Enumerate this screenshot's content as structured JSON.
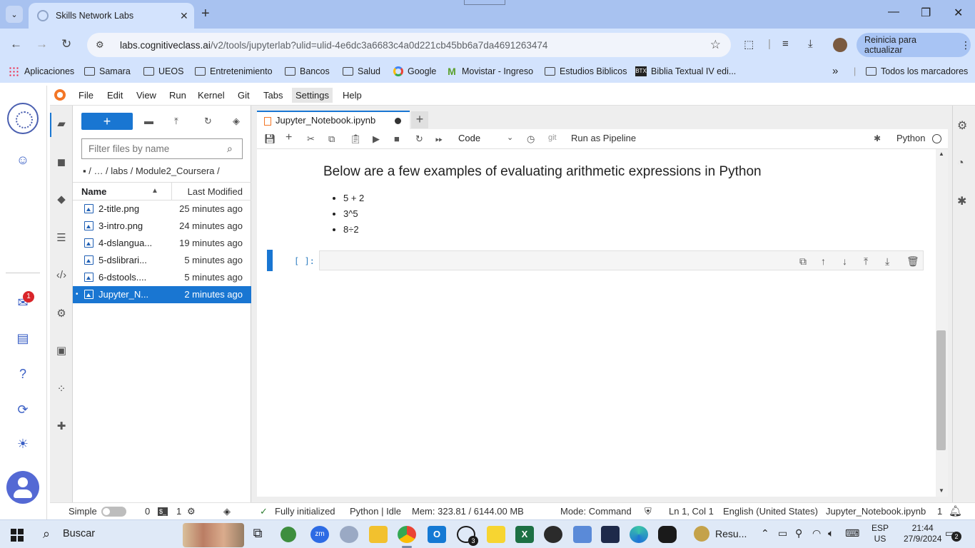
{
  "browser": {
    "tab_title": "Skills Network Labs",
    "tab_close": "✕",
    "new_tab": "+",
    "url_host": "labs.cognitiveclass.ai",
    "url_path": "/v2/tools/jupyterlab?ulid=ulid-4e6dc3a6683c4a0d221cb45bb6a7da4691263474",
    "update_button": "Reinicia para actualizar",
    "window_controls": {
      "minimize": "—",
      "restore": "❐",
      "close": "✕"
    }
  },
  "bookmarks": [
    {
      "label": "Aplicaciones",
      "icon": "apps-grid-icon"
    },
    {
      "label": "Samara",
      "icon": "folder-icon"
    },
    {
      "label": "UEOS",
      "icon": "folder-icon"
    },
    {
      "label": "Entretenimiento",
      "icon": "folder-icon"
    },
    {
      "label": "Bancos",
      "icon": "folder-icon"
    },
    {
      "label": "Salud",
      "icon": "folder-icon"
    },
    {
      "label": "Google",
      "icon": "google-icon"
    },
    {
      "label": "Movistar - Ingreso",
      "icon": "movistar-icon"
    },
    {
      "label": "Estudios Biblicos",
      "icon": "folder-icon"
    },
    {
      "label": "Biblia Textual IV edi...",
      "icon": "bible-icon"
    }
  ],
  "bookmarks_overflow": "»",
  "bookmarks_all": "Todos los marcadores",
  "jupyter_menu": [
    "File",
    "Edit",
    "View",
    "Run",
    "Kernel",
    "Git",
    "Tabs",
    "Settings",
    "Help"
  ],
  "skills_network": {
    "notification_count": "1",
    "icons": [
      "skills-network-logo-icon",
      "chat-icon",
      "inbox-icon",
      "document-icon",
      "help-icon",
      "refresh-icon",
      "theme-icon",
      "user-avatar-icon"
    ]
  },
  "file_browser": {
    "new_button": "+",
    "filter_placeholder": "Filter files by name",
    "breadcrumb": "▪ /   …   / labs / Module2_Coursera /",
    "col_name": "Name",
    "col_modified": "Last Modified",
    "files": [
      {
        "name": "2-title.png",
        "modified": "25 minutes ago"
      },
      {
        "name": "3-intro.png",
        "modified": "24 minutes ago"
      },
      {
        "name": "4-dslangua...",
        "modified": "19 minutes ago"
      },
      {
        "name": "5-dslibrari...",
        "modified": "5 minutes ago"
      },
      {
        "name": "6-dstools....",
        "modified": "5 minutes ago"
      },
      {
        "name": "Jupyter_N...",
        "modified": "2 minutes ago",
        "selected": true
      }
    ]
  },
  "notebook": {
    "tab_title": "Jupyter_Notebook.ipynb",
    "cell_type": "Code",
    "run_pipeline": "Run as Pipeline",
    "git_label": "git",
    "kernel": "Python",
    "heading": "Below are a few examples of evaluating arithmetic expressions in Python",
    "examples": [
      "5 + 2",
      "3^5",
      "8÷2"
    ],
    "cell_prompt": "[ ]:"
  },
  "statusbar": {
    "mode_simple": "Simple",
    "terminals": "0",
    "kernels": "1",
    "initialized": "Fully initialized",
    "kernel_status": "Python | Idle",
    "memory": "Mem: 323.81 / 6144.00 MB",
    "mode": "Mode: Command",
    "cursor": "Ln 1, Col 1",
    "language": "English (United States)",
    "filename": "Jupyter_Notebook.ipynb",
    "notif_count": "1"
  },
  "taskbar": {
    "search": "Buscar",
    "resume_label": "Resu...",
    "whatsapp_count": "3",
    "lang_top": "ESP",
    "lang_bottom": "US",
    "time": "21:44",
    "date": "27/9/2024",
    "notifications": "2"
  }
}
